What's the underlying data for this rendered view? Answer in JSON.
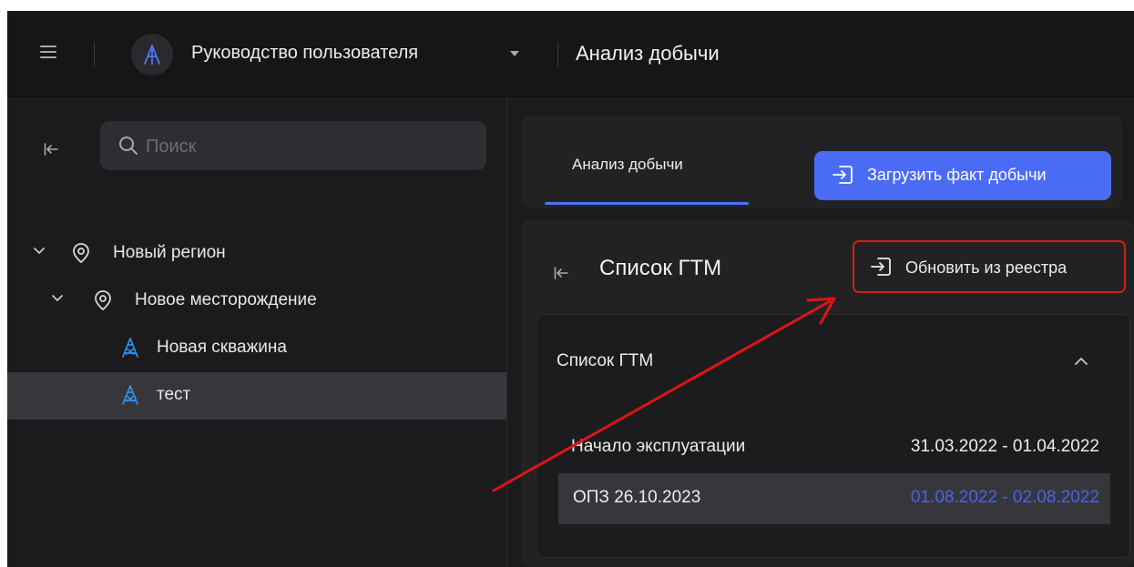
{
  "header": {
    "app_name": "Руководство пользователя",
    "page_title": "Анализ добычи",
    "icons": [
      "menu-icon",
      "app-logo-icon",
      "caret-down-icon"
    ]
  },
  "sidebar": {
    "search": {
      "placeholder": "Поиск",
      "value": ""
    },
    "tree": [
      {
        "label": "Новый регион",
        "icon": "location-pin-icon",
        "expanded": true,
        "level": 0
      },
      {
        "label": "Новое месторождение",
        "icon": "location-pin-icon",
        "expanded": true,
        "level": 1
      },
      {
        "label": "Новая скважина",
        "icon": "well-tower-icon",
        "level": 2
      },
      {
        "label": "тест",
        "icon": "well-tower-icon",
        "level": 2,
        "selected": true
      }
    ]
  },
  "main": {
    "tabs": [
      {
        "label": "Анализ добычи",
        "active": true
      }
    ],
    "load_button_label": "Загрузить факт добычи",
    "gtm_panel": {
      "title": "Список ГТМ",
      "refresh_button_label": "Обновить из реестра",
      "card": {
        "title": "Список ГТМ",
        "rows": [
          {
            "name": "Начало эксплуатации",
            "range": "31.03.2022 - 01.04.2022",
            "selected": false
          },
          {
            "name": "ОПЗ 26.10.2023",
            "range": "01.08.2022 - 02.08.2022",
            "selected": true
          }
        ]
      }
    }
  },
  "colors": {
    "background": "#1b1b1d",
    "topbar": "#161617",
    "accent_blue": "#4a6cf4",
    "selected_row": "#37373b",
    "highlight_red": "#d31d1d",
    "well_icon_blue": "#2f8fe6",
    "range_link_blue": "#4a63e6"
  }
}
